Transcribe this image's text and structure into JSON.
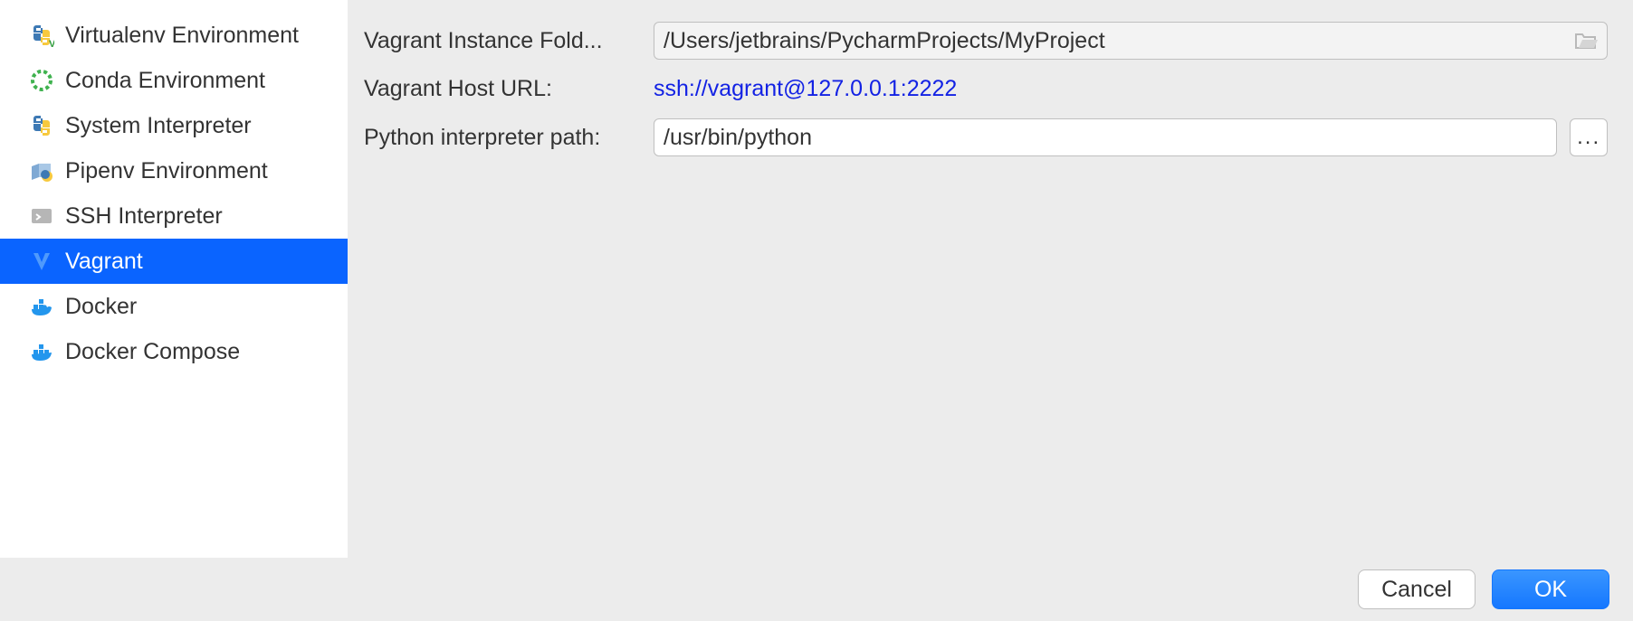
{
  "sidebar": {
    "items": [
      {
        "label": "Virtualenv Environment",
        "selected": false,
        "icon": "python-v-icon"
      },
      {
        "label": "Conda Environment",
        "selected": false,
        "icon": "conda-icon"
      },
      {
        "label": "System Interpreter",
        "selected": false,
        "icon": "python-icon"
      },
      {
        "label": "Pipenv Environment",
        "selected": false,
        "icon": "pipenv-icon"
      },
      {
        "label": "SSH Interpreter",
        "selected": false,
        "icon": "ssh-icon"
      },
      {
        "label": "Vagrant",
        "selected": true,
        "icon": "vagrant-icon"
      },
      {
        "label": "Docker",
        "selected": false,
        "icon": "docker-icon"
      },
      {
        "label": "Docker Compose",
        "selected": false,
        "icon": "docker-compose-icon"
      }
    ]
  },
  "form": {
    "vagrant_folder_label": "Vagrant Instance Fold...",
    "vagrant_folder_value": "/Users/jetbrains/PycharmProjects/MyProject",
    "vagrant_url_label": "Vagrant Host URL:",
    "vagrant_url_value": "ssh://vagrant@127.0.0.1:2222",
    "python_path_label": "Python interpreter path:",
    "python_path_value": "/usr/bin/python",
    "browse_label": "..."
  },
  "footer": {
    "cancel": "Cancel",
    "ok": "OK"
  }
}
